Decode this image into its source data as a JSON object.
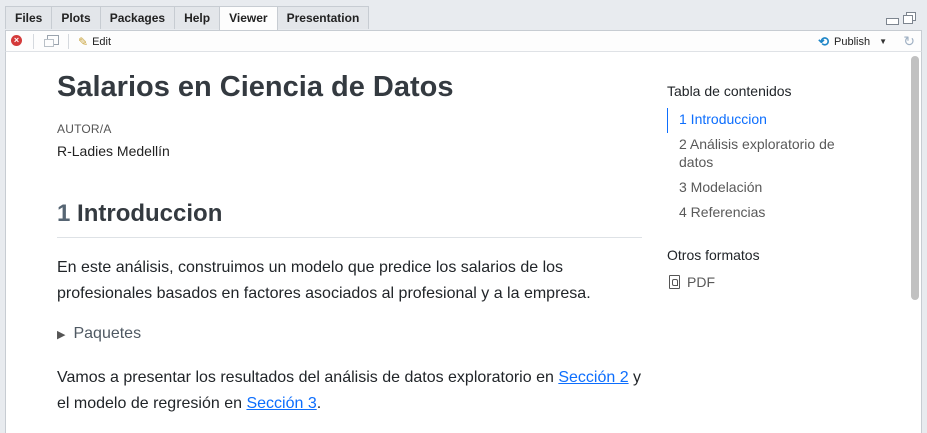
{
  "tabs": [
    {
      "label": "Files",
      "active": false
    },
    {
      "label": "Plots",
      "active": false
    },
    {
      "label": "Packages",
      "active": false
    },
    {
      "label": "Help",
      "active": false
    },
    {
      "label": "Viewer",
      "active": true
    },
    {
      "label": "Presentation",
      "active": false
    }
  ],
  "toolbar": {
    "edit_label": "Edit",
    "publish_label": "Publish"
  },
  "document": {
    "title": "Salarios en Ciencia de Datos",
    "author_label": "AUTOR/A",
    "author_name": "R-Ladies Medellín",
    "section": {
      "number": "1",
      "title": "Introduccion"
    },
    "paragraph1": "En este análisis, construimos un modelo que predice los salarios de los profesionales basados en factores asociados al profesional y a la empresa.",
    "details_summary": "Paquetes",
    "paragraph2": {
      "before": "Vamos a presentar los resultados del análisis de datos exploratorio en ",
      "link1": "Sección 2",
      "middle": " y el modelo de regresión en ",
      "link2": "Sección 3",
      "after": "."
    }
  },
  "toc": {
    "title": "Tabla de contenidos",
    "items": [
      {
        "label": "1 Introduccion",
        "active": true
      },
      {
        "label": "2 Análisis exploratorio de datos",
        "active": false
      },
      {
        "label": "3 Modelación",
        "active": false
      },
      {
        "label": "4 Referencias",
        "active": false
      }
    ],
    "other_formats_title": "Otros formatos",
    "pdf_label": "PDF"
  },
  "colors": {
    "accent": "#0d6efd",
    "close_icon": "#d43a3a",
    "publish_icon": "#1f86c7"
  }
}
